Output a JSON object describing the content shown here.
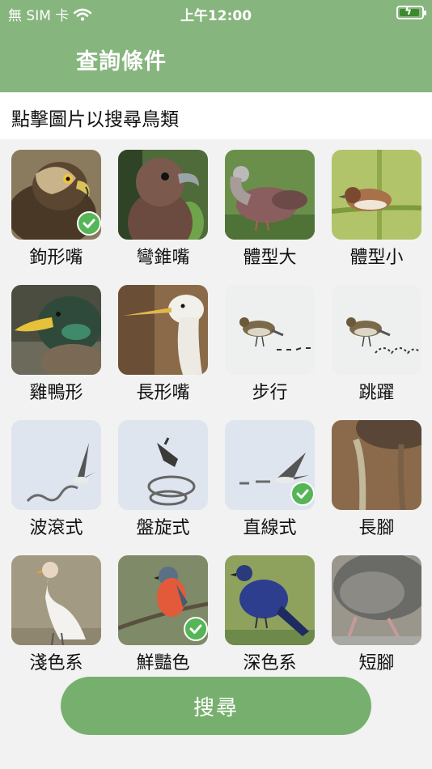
{
  "status_bar": {
    "carrier": "無 SIM 卡",
    "time": "上午12:00"
  },
  "header": {
    "title": "查詢條件"
  },
  "instruction": "點擊圖片以搜尋鳥類",
  "colors": {
    "header": "#86b57d",
    "button": "#77b06e",
    "check": "#55b557"
  },
  "tiles": [
    {
      "label": "鉤形嘴",
      "selected": true
    },
    {
      "label": "彎錐嘴",
      "selected": false
    },
    {
      "label": "體型大",
      "selected": false
    },
    {
      "label": "體型小",
      "selected": false
    },
    {
      "label": "雞鴨形",
      "selected": false
    },
    {
      "label": "長形嘴",
      "selected": false
    },
    {
      "label": "步行",
      "selected": false
    },
    {
      "label": "跳躍",
      "selected": false
    },
    {
      "label": "波滾式",
      "selected": false
    },
    {
      "label": "盤旋式",
      "selected": false
    },
    {
      "label": "直線式",
      "selected": true
    },
    {
      "label": "長腳",
      "selected": false
    },
    {
      "label": "淺色系",
      "selected": false
    },
    {
      "label": "鮮豔色",
      "selected": true
    },
    {
      "label": "深色系",
      "selected": false
    },
    {
      "label": "短腳",
      "selected": false
    }
  ],
  "search_button": {
    "label": "搜尋"
  }
}
